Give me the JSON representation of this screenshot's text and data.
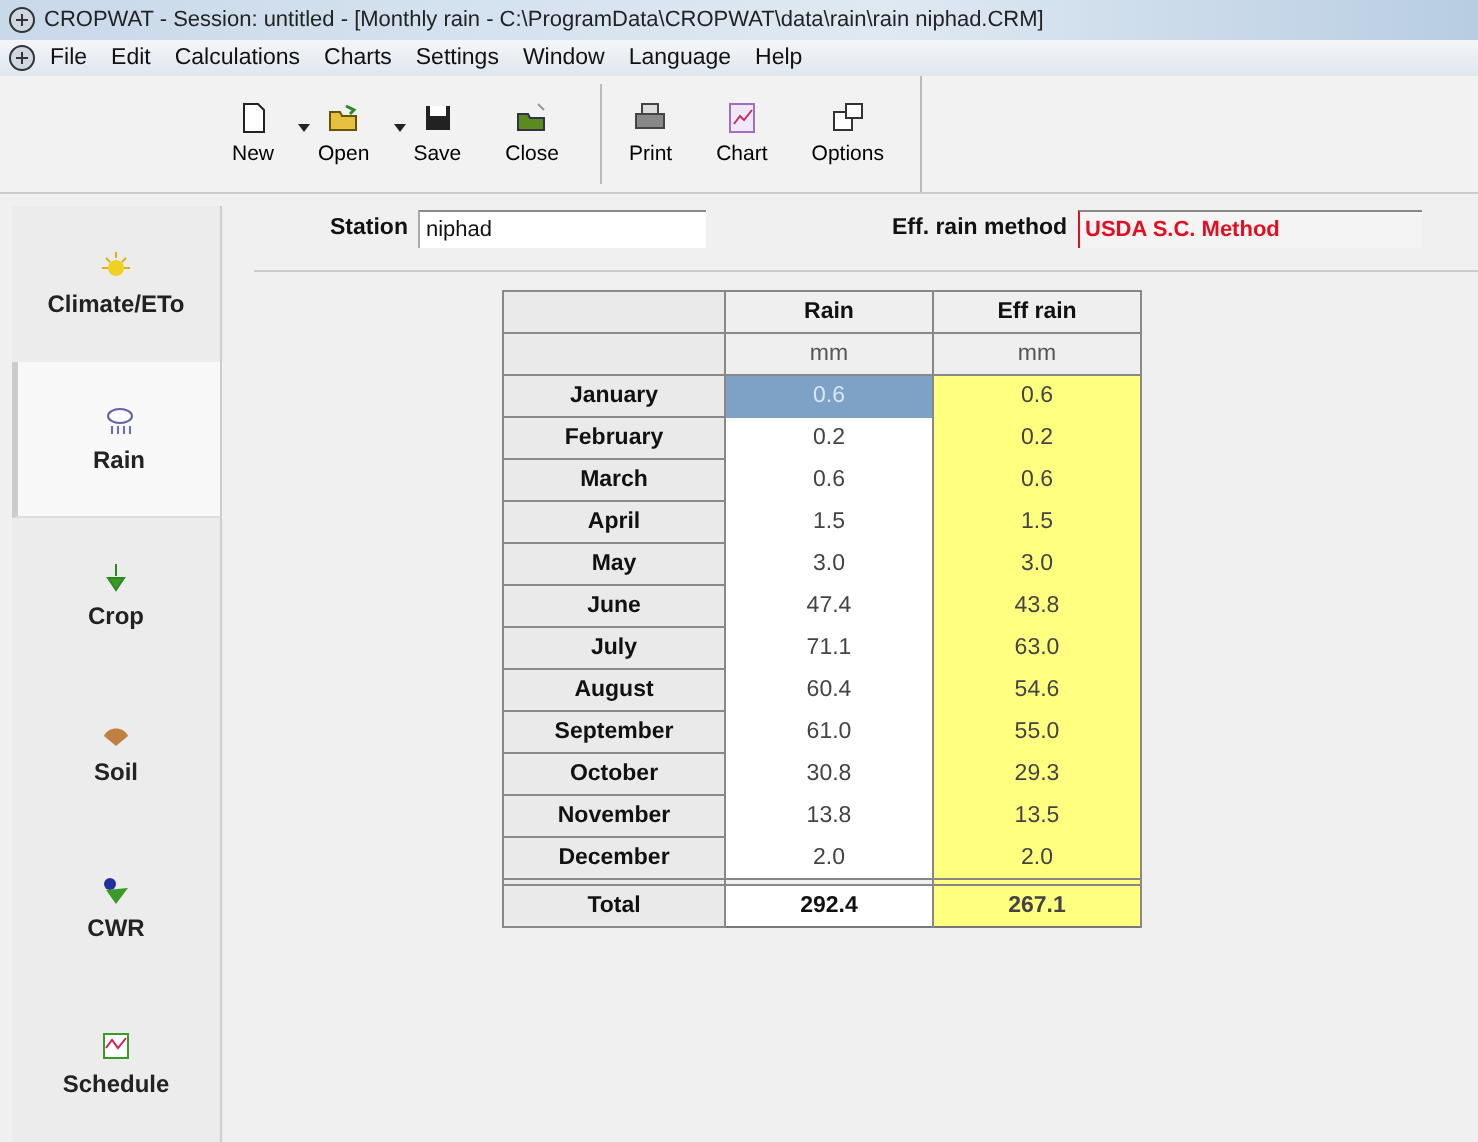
{
  "window": {
    "title": "CROPWAT - Session: untitled - [Monthly rain - C:\\ProgramData\\CROPWAT\\data\\rain\\rain niphad.CRM]"
  },
  "menu": [
    "File",
    "Edit",
    "Calculations",
    "Charts",
    "Settings",
    "Window",
    "Language",
    "Help"
  ],
  "toolbar": [
    {
      "label": "New",
      "kind": "new",
      "dropdown": true
    },
    {
      "label": "Open",
      "kind": "open",
      "dropdown": true
    },
    {
      "label": "Save",
      "kind": "save",
      "dropdown": false
    },
    {
      "label": "Close",
      "kind": "close",
      "dropdown": false
    },
    {
      "label": "Print",
      "kind": "print",
      "dropdown": false
    },
    {
      "label": "Chart",
      "kind": "chart",
      "dropdown": false
    },
    {
      "label": "Options",
      "kind": "options",
      "dropdown": false
    }
  ],
  "sidebar": {
    "items": [
      {
        "label": "Climate/ETo",
        "kind": "climate",
        "selected": false
      },
      {
        "label": "Rain",
        "kind": "rain",
        "selected": true
      },
      {
        "label": "Crop",
        "kind": "crop",
        "selected": false
      },
      {
        "label": "Soil",
        "kind": "soil",
        "selected": false
      },
      {
        "label": "CWR",
        "kind": "cwr",
        "selected": false
      },
      {
        "label": "Schedule",
        "kind": "schedule",
        "selected": false
      }
    ]
  },
  "station": {
    "label": "Station",
    "value": "niphad"
  },
  "eff_rain_method": {
    "label": "Eff. rain method",
    "value": "USDA S.C. Method"
  },
  "table": {
    "columns": [
      "Rain",
      "Eff rain"
    ],
    "units": [
      "mm",
      "mm"
    ],
    "rows": [
      {
        "month": "January",
        "rain": "0.6",
        "eff": "0.6",
        "selected": true
      },
      {
        "month": "February",
        "rain": "0.2",
        "eff": "0.2",
        "selected": false
      },
      {
        "month": "March",
        "rain": "0.6",
        "eff": "0.6",
        "selected": false
      },
      {
        "month": "April",
        "rain": "1.5",
        "eff": "1.5",
        "selected": false
      },
      {
        "month": "May",
        "rain": "3.0",
        "eff": "3.0",
        "selected": false
      },
      {
        "month": "June",
        "rain": "47.4",
        "eff": "43.8",
        "selected": false
      },
      {
        "month": "July",
        "rain": "71.1",
        "eff": "63.0",
        "selected": false
      },
      {
        "month": "August",
        "rain": "60.4",
        "eff": "54.6",
        "selected": false
      },
      {
        "month": "September",
        "rain": "61.0",
        "eff": "55.0",
        "selected": false
      },
      {
        "month": "October",
        "rain": "30.8",
        "eff": "29.3",
        "selected": false
      },
      {
        "month": "November",
        "rain": "13.8",
        "eff": "13.5",
        "selected": false
      },
      {
        "month": "December",
        "rain": "2.0",
        "eff": "2.0",
        "selected": false
      }
    ],
    "total": {
      "label": "Total",
      "rain": "292.4",
      "eff": "267.1"
    }
  }
}
